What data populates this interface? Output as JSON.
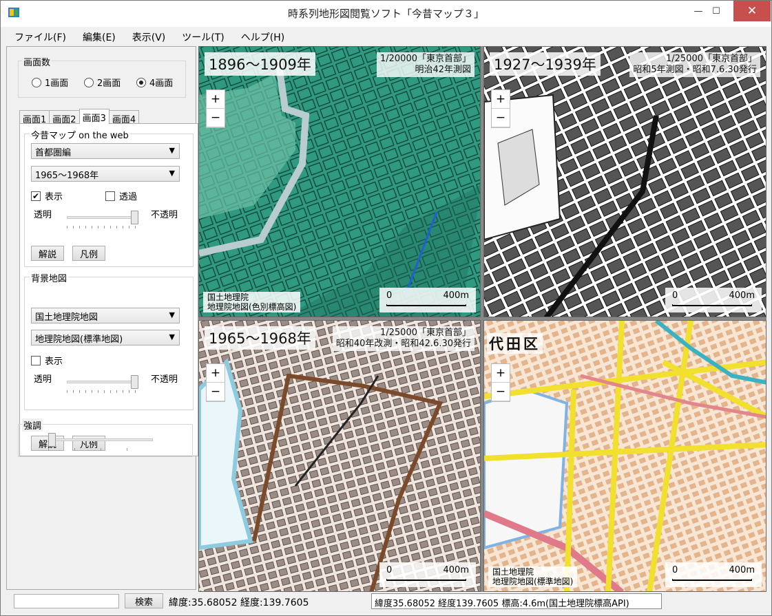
{
  "window": {
    "title": "時系列地形図閲覧ソフト「今昔マップ３」",
    "minimize": "—",
    "maximize": "☐",
    "close": "✕"
  },
  "menu": [
    "ファイル(F)",
    "編集(E)",
    "表示(V)",
    "ツール(T)",
    "ヘルプ(H)"
  ],
  "screen_count": {
    "legend": "画面数",
    "options": [
      {
        "label": "1画面",
        "selected": false
      },
      {
        "label": "2画面",
        "selected": false
      },
      {
        "label": "4画面",
        "selected": true
      }
    ]
  },
  "tabs": [
    {
      "label": "画面1",
      "active": false
    },
    {
      "label": "画面2",
      "active": false
    },
    {
      "label": "画面3",
      "active": true
    },
    {
      "label": "画面4",
      "active": false
    }
  ],
  "konjaku": {
    "legend": "今昔マップ on the web",
    "region": "首都圏編",
    "period": "1965～1968年",
    "show_label": "表示",
    "show_checked": true,
    "transparent_label": "透過",
    "transparent_checked": false,
    "opacity_min": "透明",
    "opacity_max": "不透明",
    "opacity_level": 1.0,
    "explain_button": "解説",
    "legend_button": "凡例"
  },
  "background_map": {
    "legend": "背景地図",
    "provider": "国土地理院地図",
    "map_type": "地理院地図(標準地図)",
    "show_label": "表示",
    "show_checked": false,
    "opacity_min": "透明",
    "opacity_max": "不透明",
    "opacity_level": 1.0,
    "explain_button": "解説",
    "legend_button": "凡例"
  },
  "emphasis": {
    "legend": "強調",
    "level": 0.0
  },
  "maps": [
    {
      "period": "1896～1909年",
      "info_line1": "1/20000「東京首部」",
      "info_line2": "明治42年測図",
      "attrib_line1": "国土地理院",
      "attrib_line2": "地理院地図(色別標高図)",
      "scale_min": "0",
      "scale_max": "400m"
    },
    {
      "period": "1927～1939年",
      "info_line1": "1/25000「東京首部」",
      "info_line2": "昭和5年測図・昭和7.6.30発行",
      "scale_min": "0",
      "scale_max": "400m"
    },
    {
      "period": "1965～1968年",
      "info_line1": "1/25000「東京首部」",
      "info_line2": "昭和40年改測・昭和42.6.30発行",
      "scale_min": "0",
      "scale_max": "400m"
    },
    {
      "district": "代田区",
      "attrib_line1": "国土地理院",
      "attrib_line2": "地理院地図(標準地図)",
      "scale_min": "0",
      "scale_max": "400m"
    }
  ],
  "zoom": {
    "plus": "+",
    "minus": "−"
  },
  "status": {
    "search_value": "",
    "search_button": "検索",
    "coords": "緯度:35.68052 経度:139.7605",
    "elevation": "緯度35.68052 経度139.7605 標高:4.6m(国土地理院標高API)"
  }
}
